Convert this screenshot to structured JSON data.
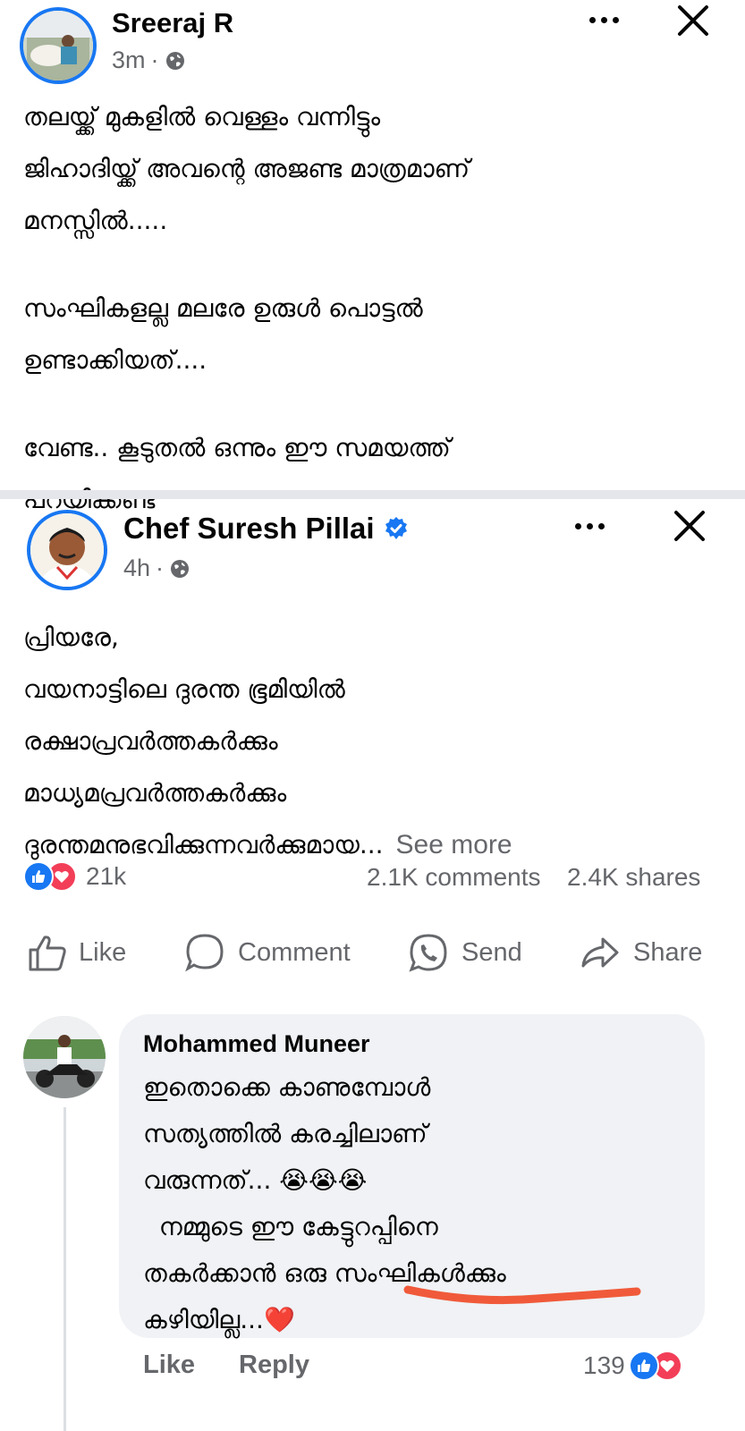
{
  "post1": {
    "author": "Sreeraj R",
    "time": "3m",
    "dot": "·",
    "lines": [
      "തലയ്ക്ക് മുകളിൽ വെള്ളം വന്നിട്ടും",
      "ജിഹാദിയ്ക്ക് അവന്റെ അജണ്ട മാത്രമാണ്",
      "മനസ്സിൽ.....",
      "",
      "സംഘികളല്ല മലരേ ഉരുൾ പൊട്ടൽ",
      "ഉണ്ടാക്കിയത്....",
      "",
      "വേണ്ട.. കൂടുതൽ ഒന്നും ഈ സമയത്ത്",
      "പറയിക്കണ്ട"
    ]
  },
  "post2": {
    "author": "Chef Suresh Pillai",
    "time": "4h",
    "dot": "·",
    "lines": [
      "പ്രിയരേ,",
      "വയനാട്ടിലെ ദുരന്ത ഭൂമിയിൽ",
      "രക്ഷാപ്രവർത്തകർക്കും",
      "മാധ്യമപ്രവർത്തകർക്കും",
      "ദുരന്തമനുഭവിക്കുന്നവർക്കുമായ..."
    ],
    "see_more": "See more",
    "reaction_count": "21k",
    "comments": "2.1K comments",
    "shares": "2.4K shares",
    "actions": {
      "like": "Like",
      "comment": "Comment",
      "send": "Send",
      "share": "Share"
    }
  },
  "comment": {
    "author": "Mohammed Muneer",
    "line1": "ഇതൊക്കെ കാണുമ്പോൾ",
    "line2": "സത്യത്തിൽ കരച്ചിലാണ്",
    "line3": "വരുന്നത്... 😭😭😭",
    "line4": "  നമ്മുടെ ഈ കേട്ടുറപ്പിനെ",
    "line5": "തകർക്കാൻ ഒരു സംഘികൾക്കും",
    "line6": "കഴിയില്ല...❤️",
    "like": "Like",
    "reply": "Reply",
    "reaction_count": "139"
  },
  "colors": {
    "accent": "#1877f2",
    "love": "#f33e58",
    "muted": "#65676b",
    "bubble": "#f0f2f5",
    "underline": "#f05a3a"
  }
}
